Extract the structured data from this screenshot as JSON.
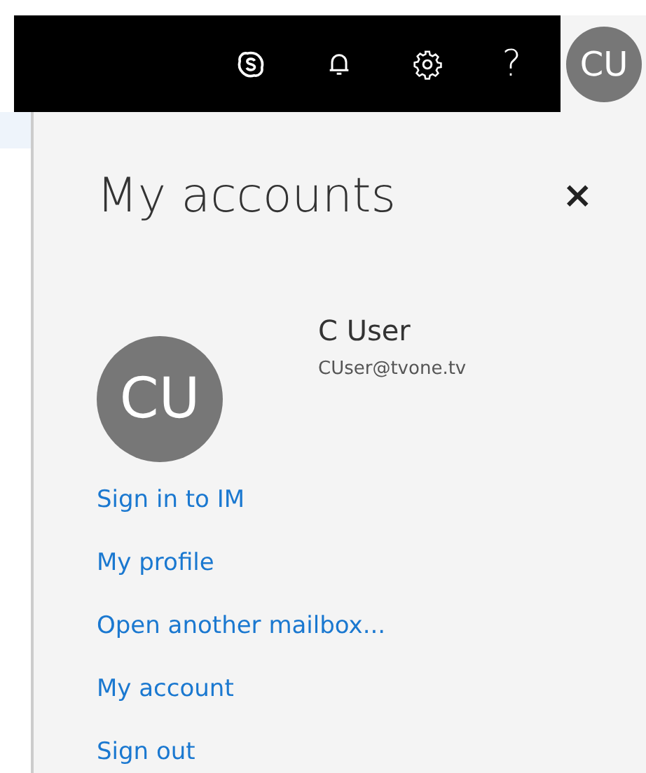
{
  "top_bar": {
    "help": "?",
    "avatar": "CU"
  },
  "panel": {
    "title": "My accounts",
    "close": "×",
    "avatar": "CU",
    "name": "C User",
    "email": "CUser@tvone.tv",
    "links": [
      "Sign in to IM",
      "My profile",
      "Open another mailbox...",
      "My account",
      "Sign out"
    ]
  }
}
